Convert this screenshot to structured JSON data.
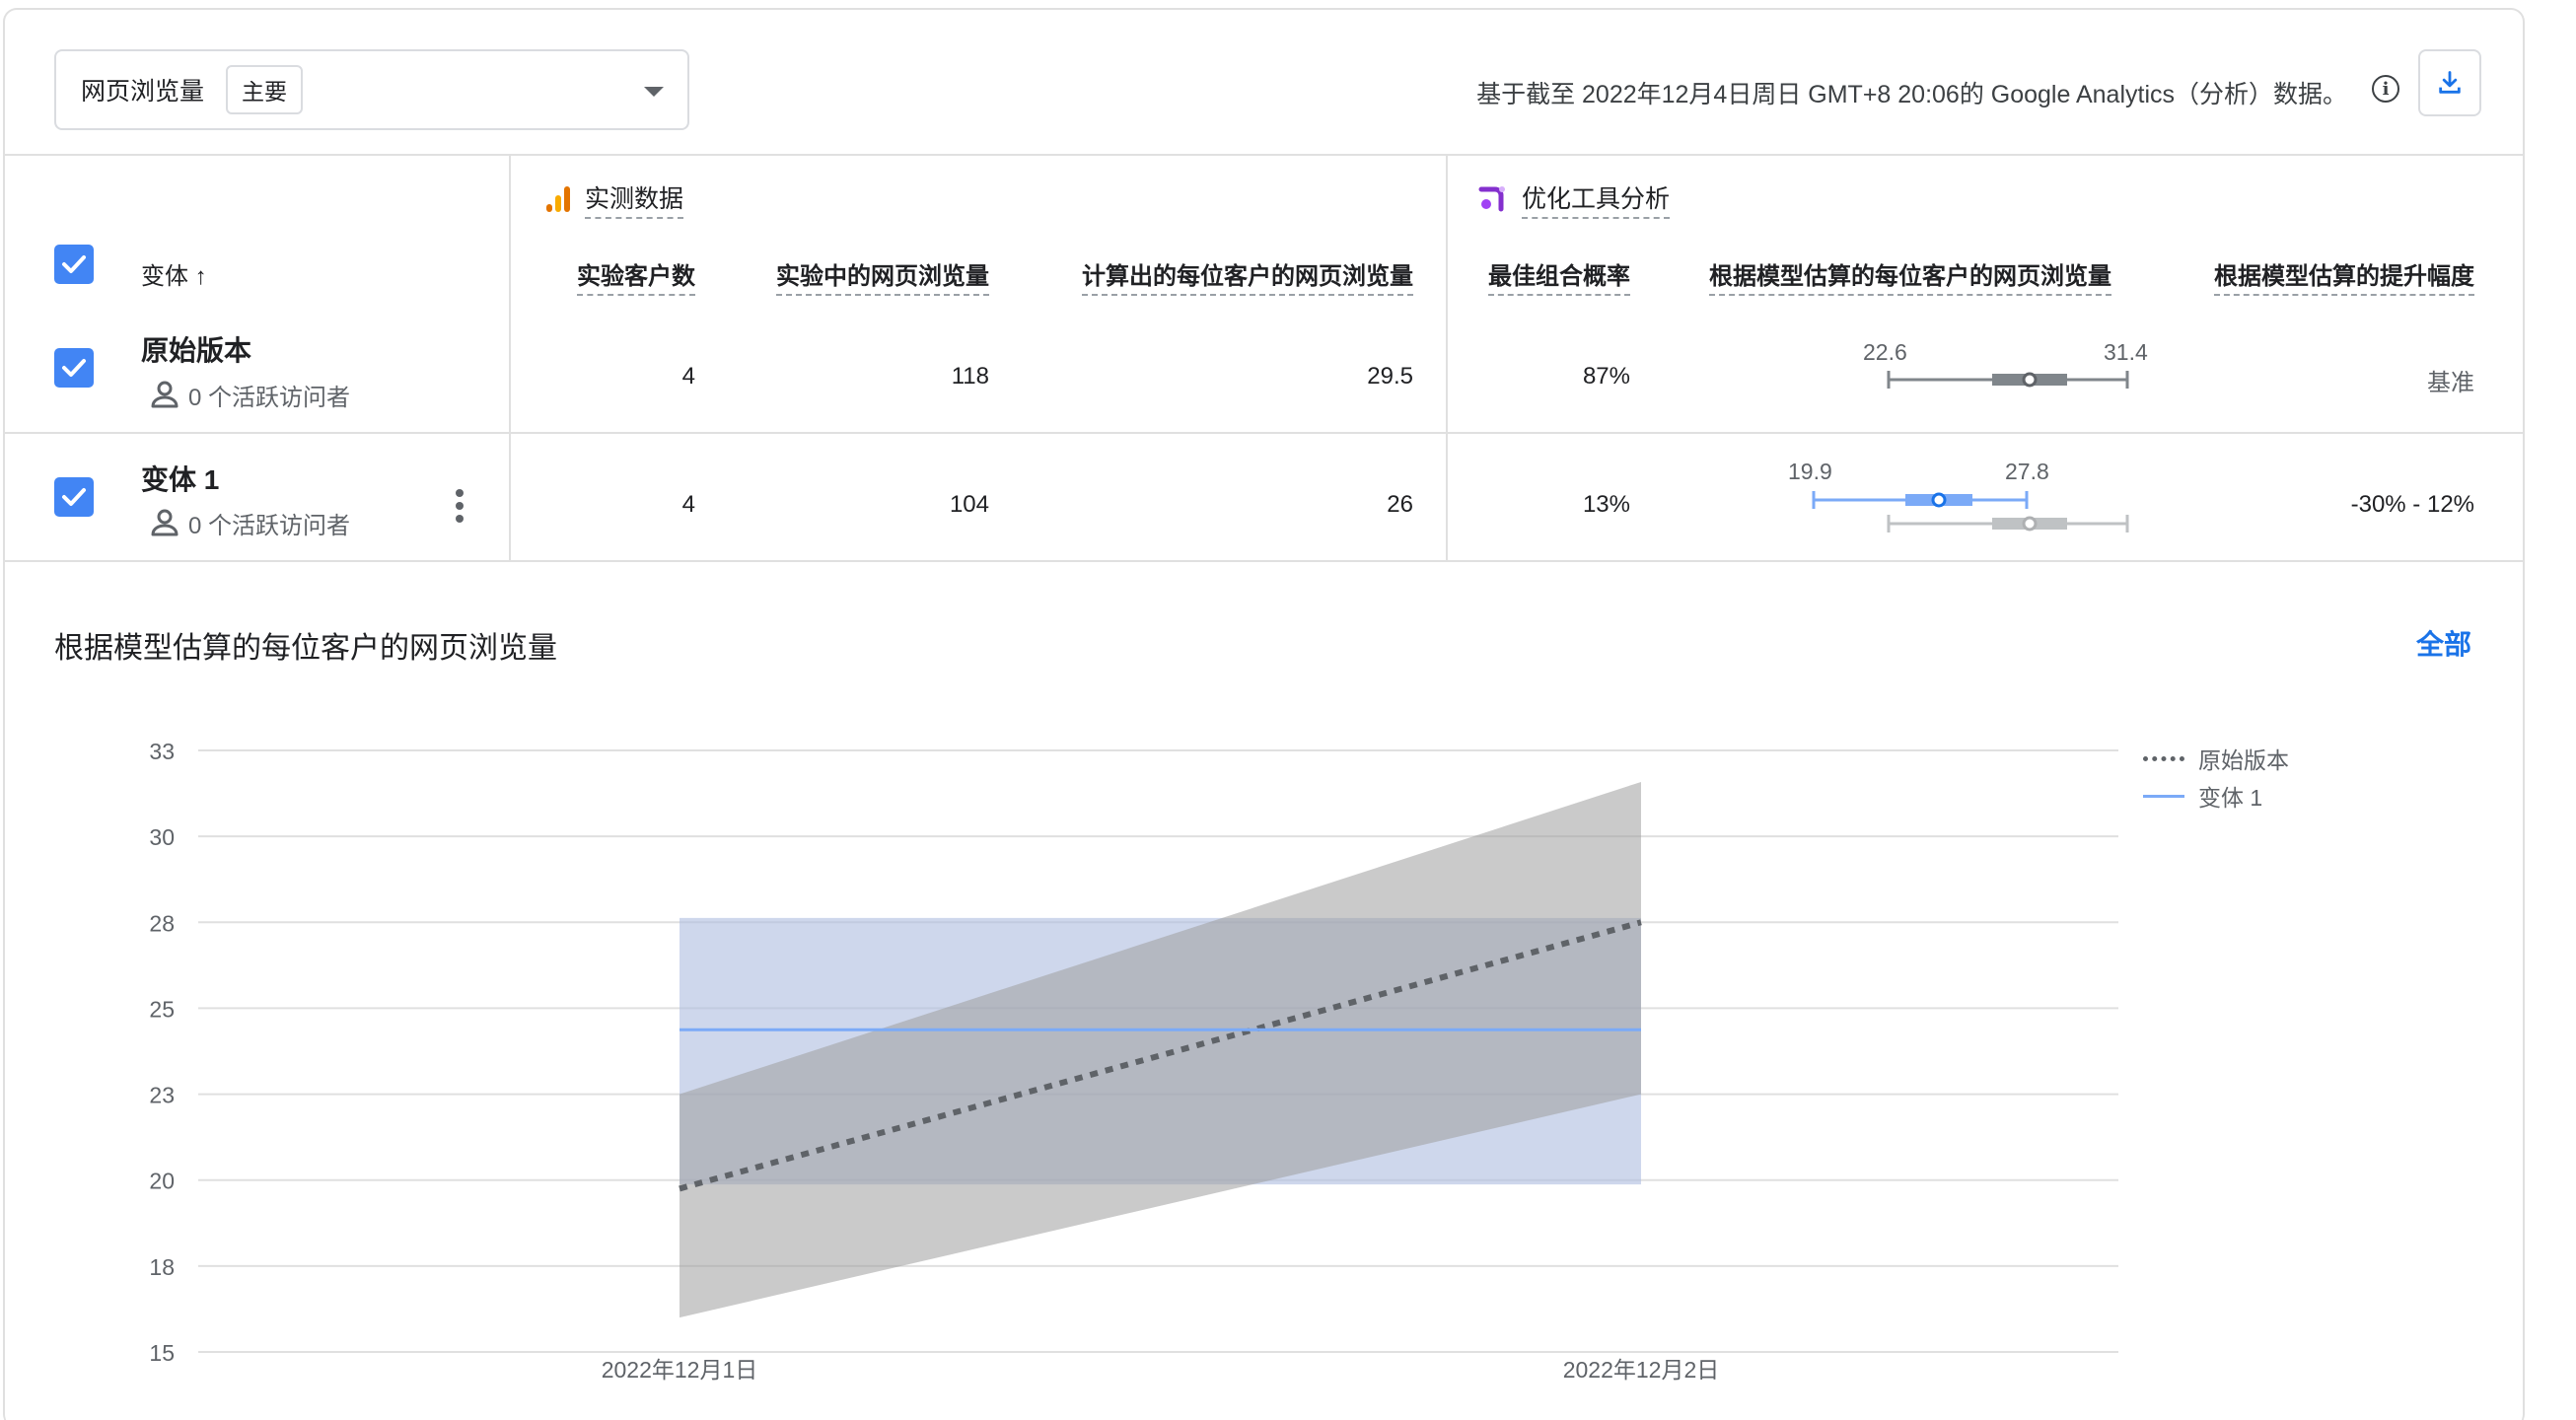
{
  "header": {
    "metric_label": "网页浏览量",
    "metric_chip": "主要",
    "data_note": "基于截至 2022年12月4日周日 GMT+8 20:06的 Google Analytics（分析）数据。",
    "info_icon": "info-icon",
    "download_icon": "download-icon"
  },
  "table": {
    "variant_header": "变体 ↑",
    "observed_group": "实测数据",
    "optimizer_group": "优化工具分析",
    "columns": {
      "users": "实验客户数",
      "pageviews": "实验中的网页浏览量",
      "per_user": "计算出的每位客户的网页浏览量",
      "best_prob": "最佳组合概率",
      "modeled_per_user": "根据模型估算的每位客户的网页浏览量",
      "modeled_lift": "根据模型估算的提升幅度"
    },
    "rows": [
      {
        "name": "原始版本",
        "visitors": "0 个活跃访问者",
        "users": "4",
        "pageviews": "118",
        "per_user": "29.5",
        "best_prob": "87%",
        "ci_low": "22.6",
        "ci_high": "31.4",
        "lift": "基准"
      },
      {
        "name": "变体 1",
        "visitors": "0 个活跃访问者",
        "users": "4",
        "pageviews": "104",
        "per_user": "26",
        "best_prob": "13%",
        "ci_low": "19.9",
        "ci_high": "27.8",
        "lift": "-30% - 12%"
      }
    ],
    "colors": {
      "checkbox": "#4285f4",
      "original_ci": "#80868b",
      "variant_ci": "#7baaf7"
    }
  },
  "chart": {
    "title": "根据模型估算的每位客户的网页浏览量",
    "all_link": "全部",
    "legend": [
      {
        "name": "原始版本",
        "style": "dashed",
        "color": "#5f6368"
      },
      {
        "name": "变体 1",
        "style": "solid",
        "color": "#7baaf7"
      }
    ]
  },
  "chart_data": {
    "type": "line",
    "title": "根据模型估算的每位客户的网页浏览量",
    "xlabel": "",
    "ylabel": "",
    "x": [
      "2022年12月1日",
      "2022年12月2日"
    ],
    "y_ticks": [
      33,
      30,
      28,
      25,
      23,
      20,
      18,
      15
    ],
    "ylim": [
      15,
      33
    ],
    "grid": true,
    "legend_position": "right",
    "series": [
      {
        "name": "原始版本",
        "values": [
          19.8,
          28.0
        ],
        "band_low": [
          16.2,
          23.0
        ],
        "band_high": [
          23.0,
          31.9
        ],
        "color": "#5f6368",
        "band_color": "#9e9e9e"
      },
      {
        "name": "变体 1",
        "values": [
          24.5,
          24.5
        ],
        "band_low": [
          19.9,
          19.9
        ],
        "band_high": [
          28.1,
          28.1
        ],
        "color": "#7baaf7",
        "band_color": "#aebde0"
      }
    ]
  }
}
